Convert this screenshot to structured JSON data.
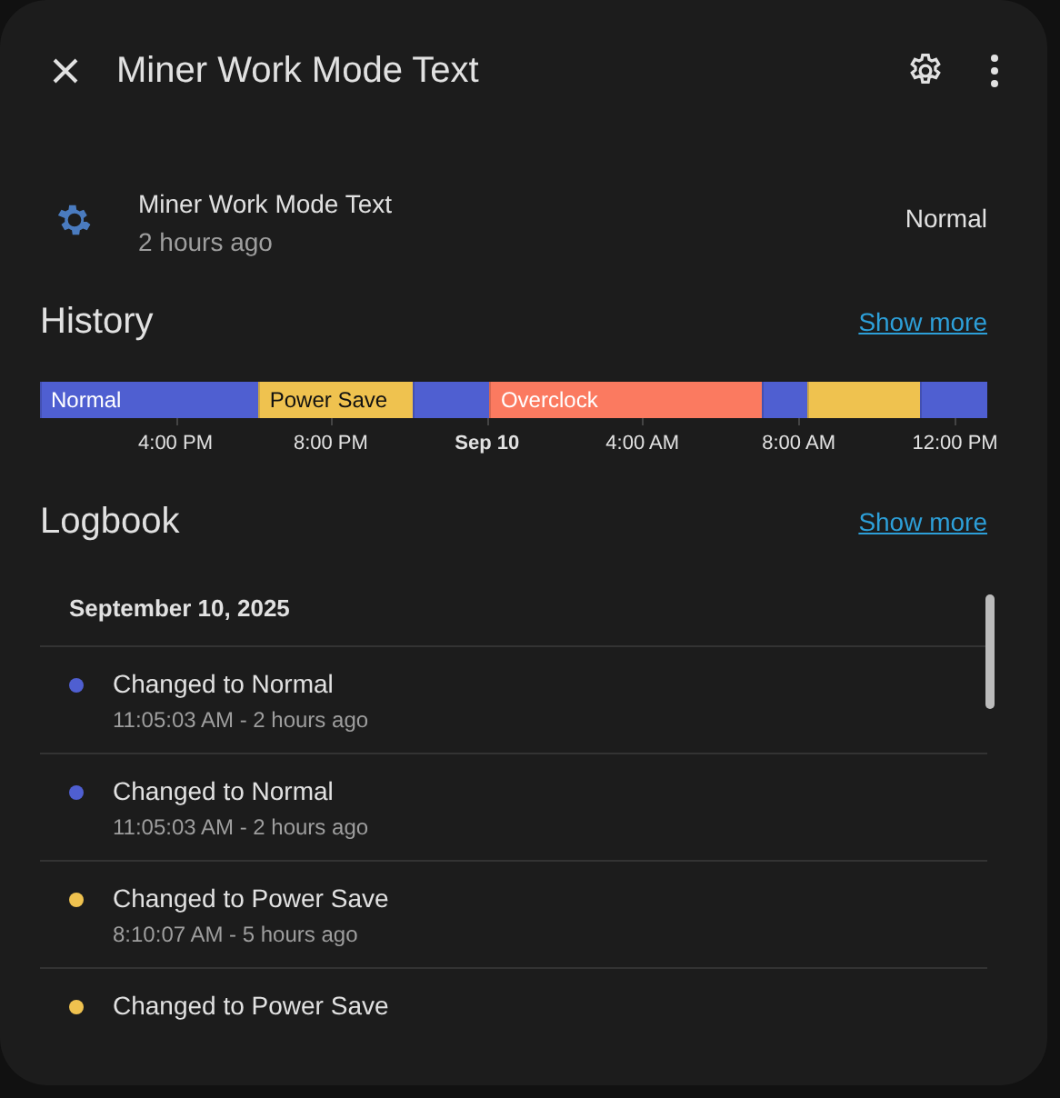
{
  "dialog": {
    "title": "Miner Work Mode Text"
  },
  "entity": {
    "name": "Miner Work Mode Text",
    "updated": "2 hours ago",
    "state": "Normal"
  },
  "history": {
    "title": "History",
    "link": "Show more",
    "timeline": {
      "segments": [
        {
          "label": "Normal",
          "color": "#4f5fd1"
        },
        {
          "label": "Power Save",
          "color": "#efc24f"
        },
        {
          "color": "#4f5fd1"
        },
        {
          "label": "Overclock",
          "color": "#fb7a60"
        },
        {
          "color": "#4f5fd1"
        },
        {
          "color": "#efc24f"
        },
        {
          "color": "#4f5fd1"
        }
      ],
      "ticks": [
        {
          "label": "4:00 PM",
          "bold": false
        },
        {
          "label": "8:00 PM",
          "bold": false
        },
        {
          "label": "Sep 10",
          "bold": true
        },
        {
          "label": "4:00 AM",
          "bold": false
        },
        {
          "label": "8:00 AM",
          "bold": false
        },
        {
          "label": "12:00 PM",
          "bold": false
        }
      ]
    }
  },
  "logbook": {
    "title": "Logbook",
    "link": "Show more",
    "date": "September 10, 2025",
    "entries": [
      {
        "text": "Changed to Normal",
        "time": "11:05:03 AM - 2 hours ago",
        "color": "#4f5fd1"
      },
      {
        "text": "Changed to Normal",
        "time": "11:05:03 AM - 2 hours ago",
        "color": "#4f5fd1"
      },
      {
        "text": "Changed to Power Save",
        "time": "8:10:07 AM - 5 hours ago",
        "color": "#efc24f"
      },
      {
        "text": "Changed to Power Save",
        "color": "#efc24f"
      }
    ]
  }
}
